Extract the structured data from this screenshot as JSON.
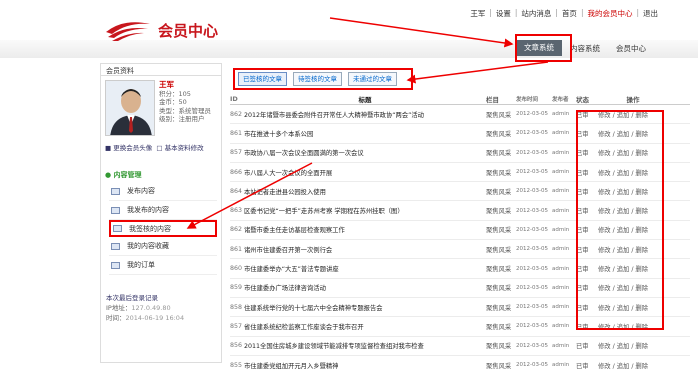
{
  "header": {
    "links": [
      "王军",
      "设置",
      "站内消息",
      "首页",
      "我的会员中心",
      "退出"
    ],
    "logo_title": "会员中心",
    "nav": [
      {
        "label": "文章系统",
        "active": true
      },
      {
        "label": "内容系统",
        "active": false
      },
      {
        "label": "会员中心",
        "active": false
      }
    ]
  },
  "sidebar": {
    "heading": "会员资料",
    "profile": {
      "name": "王军",
      "points": "积分：105",
      "money": "金币：50",
      "type": "类型：系统管理员",
      "level": "级别：注册用户"
    },
    "links": [
      "更换会员头像",
      "基本资料修改"
    ],
    "section": "内容管理",
    "menu": [
      "发布内容",
      "我发布的内容",
      "我签核的内容",
      "我的内容收藏",
      "我的订单"
    ],
    "last_login_title": "本次最后登录记录",
    "ip_label": "IP地址：",
    "ip_value": "127.0.49.80",
    "time_label": "时间：",
    "time_value": "2014-06-19 16:04"
  },
  "main": {
    "tabs": [
      "已签核的文章",
      "待签核的文章",
      "未通过的文章"
    ],
    "columns": [
      "ID",
      "标题",
      "栏目",
      "发布时间",
      "发布者",
      "状态",
      "操作"
    ],
    "rows": [
      {
        "id": "862",
        "title": "2012年诸暨市县委会附件召开常任人大精神暨市政协“两会”活动",
        "col": "聚焦风采",
        "time": "2012-03-05",
        "pub": "admin",
        "st": "已审",
        "op": "修改 / 追加 / 删除"
      },
      {
        "id": "861",
        "title": "市在推进十多个本系公园",
        "col": "聚焦风采",
        "time": "2012-03-05",
        "pub": "admin",
        "st": "已审",
        "op": "修改 / 追加 / 删除"
      },
      {
        "id": "857",
        "title": "市政协八届一次会议全面圆满的第一次会议",
        "col": "聚焦风采",
        "time": "2012-03-05",
        "pub": "admin",
        "st": "已审",
        "op": "修改 / 追加 / 删除"
      },
      {
        "id": "866",
        "title": "市八届人大一次会议的全面开展",
        "col": "聚焦风采",
        "time": "2012-03-05",
        "pub": "admin",
        "st": "已审",
        "op": "修改 / 追加 / 删除"
      },
      {
        "id": "864",
        "title": "本站记者走进县公园投入使用",
        "col": "聚焦风采",
        "time": "2012-03-05",
        "pub": "admin",
        "st": "已审",
        "op": "修改 / 追加 / 删除"
      },
      {
        "id": "863",
        "title": "区委书记党“一把手”走苏州考察 学期程在苏州挂职（图）",
        "col": "聚焦风采",
        "time": "2012-03-05",
        "pub": "admin",
        "st": "已审",
        "op": "修改 / 追加 / 删除"
      },
      {
        "id": "862",
        "title": "诸暨市委主任走访基层检查观察工作",
        "col": "聚焦风采",
        "time": "2012-03-05",
        "pub": "admin",
        "st": "已审",
        "op": "修改 / 追加 / 删除"
      },
      {
        "id": "861",
        "title": "诸州市住建委召开第一次例行会",
        "col": "聚焦风采",
        "time": "2012-03-05",
        "pub": "admin",
        "st": "已审",
        "op": "修改 / 追加 / 删除"
      },
      {
        "id": "860",
        "title": "市住建委举办“大五”普法专题讲座",
        "col": "聚焦风采",
        "time": "2012-03-05",
        "pub": "admin",
        "st": "已审",
        "op": "修改 / 追加 / 删除"
      },
      {
        "id": "859",
        "title": "市住建委办广场法律咨询活动",
        "col": "聚焦风采",
        "time": "2012-03-05",
        "pub": "admin",
        "st": "已审",
        "op": "修改 / 追加 / 删除"
      },
      {
        "id": "858",
        "title": "住建系统举行党的十七届六中全会精神专题报告会",
        "col": "聚焦风采",
        "time": "2012-03-05",
        "pub": "admin",
        "st": "已审",
        "op": "修改 / 追加 / 删除"
      },
      {
        "id": "857",
        "title": "省住建系统纪检监察工作座谈会于我市召开",
        "col": "聚焦风采",
        "time": "2012-03-05",
        "pub": "admin",
        "st": "已审",
        "op": "修改 / 追加 / 删除"
      },
      {
        "id": "856",
        "title": "2011全国住房城乡建设领域节能减排专项监督检查组对我市检查",
        "col": "聚焦风采",
        "time": "2012-03-05",
        "pub": "admin",
        "st": "已审",
        "op": "修改 / 追加 / 删除"
      },
      {
        "id": "855",
        "title": "市住建委党组加开元月入乡暨精神",
        "col": "聚焦风采",
        "time": "2012-03-05",
        "pub": "admin",
        "st": "已审",
        "op": "修改 / 追加 / 删除"
      }
    ]
  },
  "colors": {
    "accent_red": "#c8161d",
    "annotation_red": "#e00000",
    "nav_active": "#5a6570"
  }
}
